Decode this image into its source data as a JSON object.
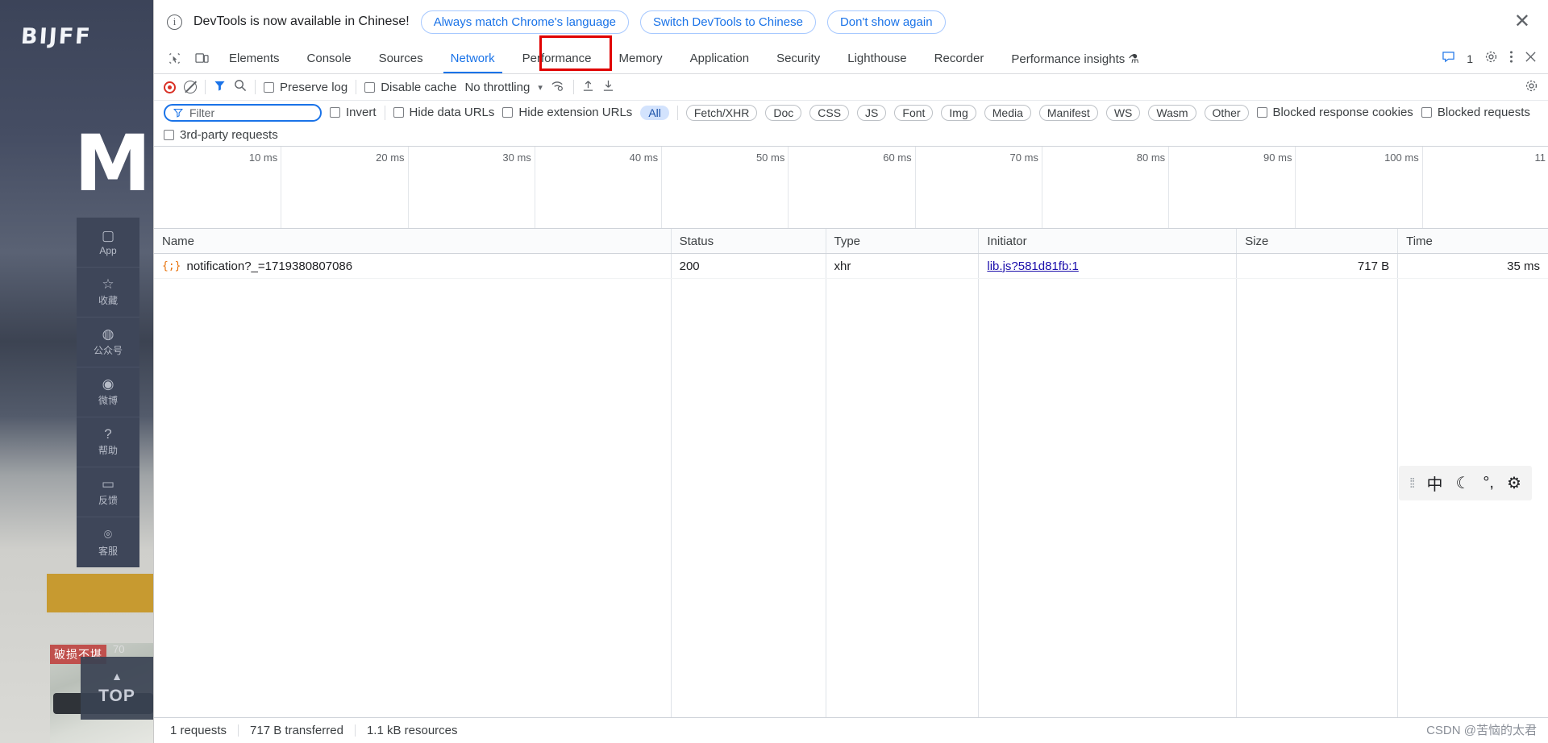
{
  "site": {
    "logo": "BIJFF",
    "hero_letter": "M",
    "damage_badge": "破损不堪",
    "price_chip": "70",
    "top_button": {
      "arrow": "▲",
      "label": "TOP"
    },
    "side_nav": [
      {
        "icon": "phone-icon",
        "glyph": "▢",
        "label": "App"
      },
      {
        "icon": "star-icon",
        "glyph": "☆",
        "label": "收藏"
      },
      {
        "icon": "wechat-icon",
        "glyph": "◍",
        "label": "公众号"
      },
      {
        "icon": "weibo-icon",
        "glyph": "◉",
        "label": "微博"
      },
      {
        "icon": "help-icon",
        "glyph": "?",
        "label": "帮助"
      },
      {
        "icon": "feedback-icon",
        "glyph": "▭",
        "label": "反馈"
      },
      {
        "icon": "headset-icon",
        "glyph": "⌾",
        "label": "客服"
      }
    ]
  },
  "banner": {
    "info_icon": "i",
    "message": "DevTools is now available in Chinese!",
    "btn_always_match": "Always match Chrome's language",
    "btn_switch": "Switch DevTools to Chinese",
    "btn_dont_show": "Don't show again",
    "close": "✕"
  },
  "tabs": {
    "inspect_icon": "cursor-select-icon",
    "device_icon": "device-toolbar-icon",
    "items": [
      {
        "label": "Elements",
        "active": false
      },
      {
        "label": "Console",
        "active": false
      },
      {
        "label": "Sources",
        "active": false
      },
      {
        "label": "Network",
        "active": true
      },
      {
        "label": "Performance",
        "active": false
      },
      {
        "label": "Memory",
        "active": false
      },
      {
        "label": "Application",
        "active": false
      },
      {
        "label": "Security",
        "active": false
      },
      {
        "label": "Lighthouse",
        "active": false
      },
      {
        "label": "Recorder",
        "active": false
      },
      {
        "label": "Performance insights ⚗",
        "active": false
      }
    ],
    "message_count": "1",
    "settings_icon": "gear-icon",
    "more_icon": "kebab-menu-icon",
    "close_icon": "close-icon"
  },
  "toolbar": {
    "record_icon": "record-stop-icon",
    "clear_icon": "clear-icon",
    "filter_icon": "filter-funnel-icon",
    "search_icon": "search-icon",
    "preserve_log": "Preserve log",
    "disable_cache": "Disable cache",
    "throttling": "No throttling",
    "throttling_caret": "▾",
    "wifi_icon": "network-conditions-icon",
    "import_icon": "import-har-icon",
    "export_icon": "export-har-icon",
    "settings_icon": "network-settings-gear-icon"
  },
  "filters": {
    "filter_placeholder": "Filter",
    "filter_value": "",
    "invert": "Invert",
    "hide_data_urls": "Hide data URLs",
    "hide_extension_urls": "Hide extension URLs",
    "chips": [
      "All",
      "Fetch/XHR",
      "Doc",
      "CSS",
      "JS",
      "Font",
      "Img",
      "Media",
      "Manifest",
      "WS",
      "Wasm",
      "Other"
    ],
    "active_chip": "All",
    "blocked_response_cookies": "Blocked response cookies",
    "blocked_requests": "Blocked requests",
    "third_party_requests": "3rd-party requests"
  },
  "timeline": {
    "ticks": [
      "10 ms",
      "20 ms",
      "30 ms",
      "40 ms",
      "50 ms",
      "60 ms",
      "70 ms",
      "80 ms",
      "90 ms",
      "100 ms",
      "11"
    ]
  },
  "table": {
    "headers": [
      "Name",
      "Status",
      "Type",
      "Initiator",
      "Size",
      "Time"
    ],
    "rows": [
      {
        "icon": "json-file-icon",
        "name": "notification?_=1719380807086",
        "status": "200",
        "type": "xhr",
        "initiator": "lib.js?581d81fb:1",
        "size": "717 B",
        "time": "35 ms"
      }
    ]
  },
  "statusbar": {
    "requests": "1 requests",
    "transferred": "717 B transferred",
    "resources": "1.1 kB resources"
  },
  "float_widget": {
    "drag_handle": "⁞⁞",
    "lang_icon": "中",
    "moon_icon": "☾",
    "punctuation_icon": "°,",
    "gear_icon": "⚙"
  },
  "watermark": "CSDN @苦恼的太君",
  "colors": {
    "accent": "#1a73e8",
    "highlight": "#e00000",
    "chip_active_bg": "#d3e3fd",
    "link": "#1a0dab"
  }
}
